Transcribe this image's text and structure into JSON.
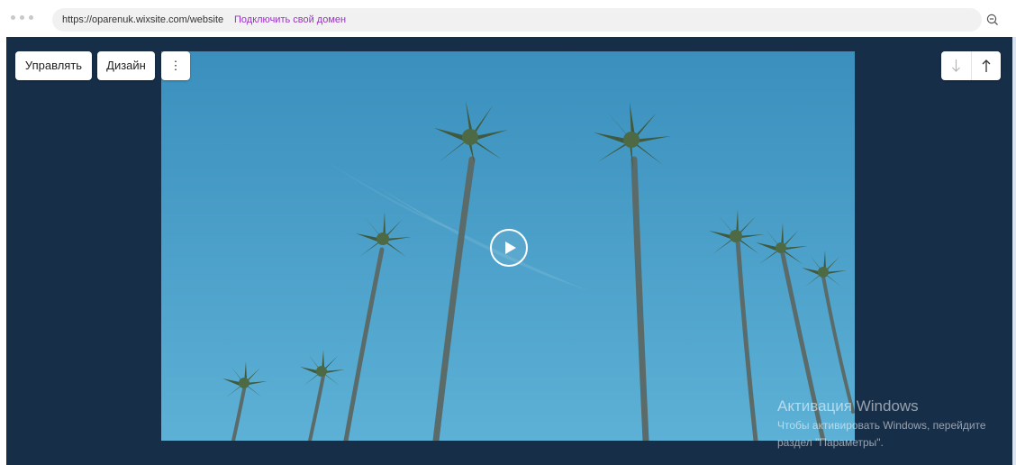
{
  "browser": {
    "url": "https://oparenuk.wixsite.com/website",
    "connect_domain_label": "Подключить свой домен"
  },
  "toolbar": {
    "manage_label": "Управлять",
    "design_label": "Дизайн",
    "more_label": "⋮"
  },
  "reorder": {
    "down_label": "↓",
    "up_label": "↑"
  },
  "watermark": {
    "title": "Активация Windows",
    "line1": "Чтобы активировать Windows, перейдите",
    "line2": "раздел \"Параметры\"."
  },
  "colors": {
    "canvas": "#172e48",
    "sky": "#4aa0c9",
    "link": "#9b30c9"
  }
}
